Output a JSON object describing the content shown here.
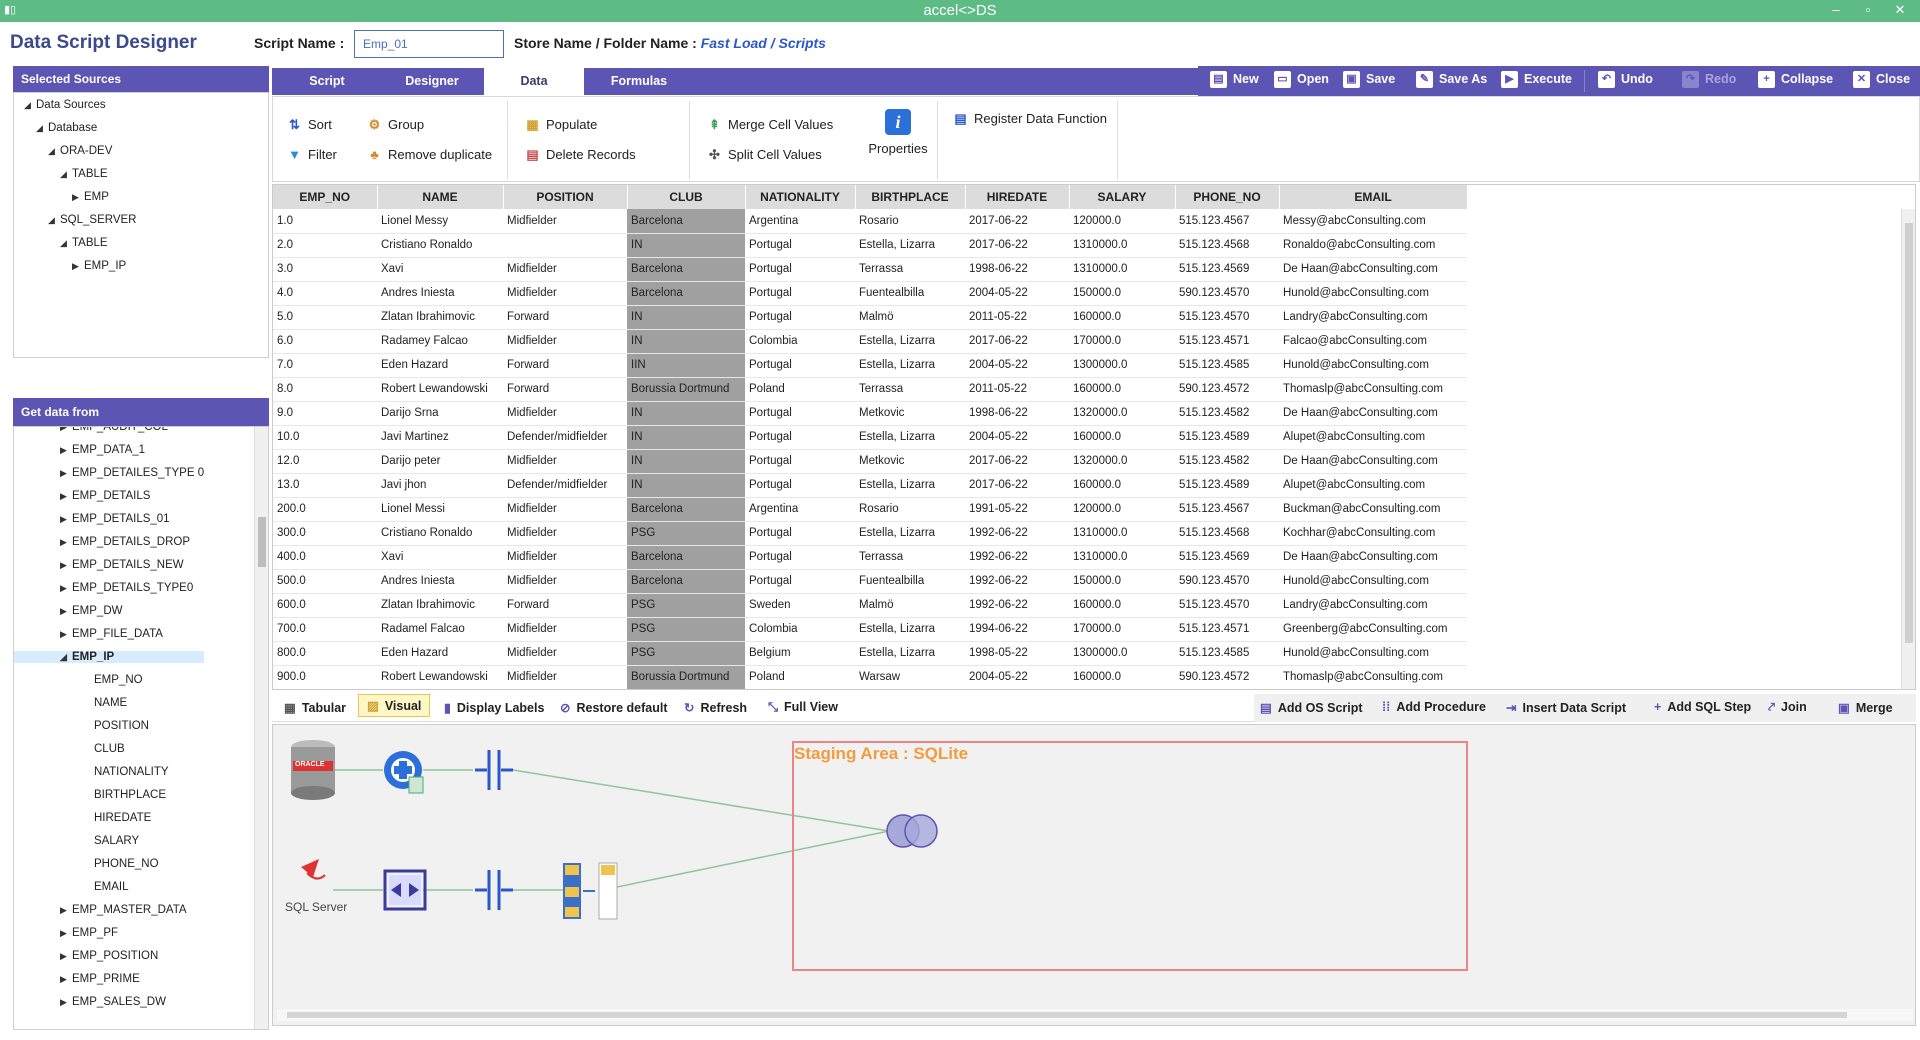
{
  "window": {
    "title": "accel<>DS",
    "min": "–",
    "max": "▫",
    "close": "✕"
  },
  "app": {
    "title": "Data Script Designer"
  },
  "script_name": {
    "label": "Script Name :",
    "value": "Emp_01"
  },
  "store": {
    "label": "Store Name / Folder Name :",
    "value": "Fast Load / Scripts"
  },
  "selected_sources": {
    "title": "Selected Sources",
    "tree": [
      {
        "label": "Data Sources",
        "level": 0,
        "open": true
      },
      {
        "label": "Database",
        "level": 1,
        "open": true
      },
      {
        "label": "ORA-DEV",
        "level": 2,
        "open": true
      },
      {
        "label": "TABLE",
        "level": 3,
        "open": true
      },
      {
        "label": "EMP",
        "level": 4,
        "open": false
      },
      {
        "label": "SQL_SERVER",
        "level": 2,
        "open": true
      },
      {
        "label": "TABLE",
        "level": 3,
        "open": true
      },
      {
        "label": "EMP_IP",
        "level": 4,
        "open": false
      }
    ]
  },
  "get_data": {
    "title": "Get data from",
    "items": [
      {
        "label": "EMP_AUDIT_COL",
        "type": "table"
      },
      {
        "label": "EMP_DATA_1",
        "type": "table"
      },
      {
        "label": "EMP_DETAILES_TYPE 0",
        "type": "table"
      },
      {
        "label": "EMP_DETAILS",
        "type": "table"
      },
      {
        "label": "EMP_DETAILS_01",
        "type": "table"
      },
      {
        "label": "EMP_DETAILS_DROP",
        "type": "table"
      },
      {
        "label": "EMP_DETAILS_NEW",
        "type": "table"
      },
      {
        "label": "EMP_DETAILS_TYPE0",
        "type": "table"
      },
      {
        "label": "EMP_DW",
        "type": "table"
      },
      {
        "label": "EMP_FILE_DATA",
        "type": "table"
      },
      {
        "label": "EMP_IP",
        "type": "table-open"
      },
      {
        "label": "EMP_NO",
        "type": "col"
      },
      {
        "label": "NAME",
        "type": "col"
      },
      {
        "label": "POSITION",
        "type": "col"
      },
      {
        "label": "CLUB",
        "type": "col"
      },
      {
        "label": "NATIONALITY",
        "type": "col"
      },
      {
        "label": "BIRTHPLACE",
        "type": "col"
      },
      {
        "label": "HIREDATE",
        "type": "col"
      },
      {
        "label": "SALARY",
        "type": "col"
      },
      {
        "label": "PHONE_NO",
        "type": "col"
      },
      {
        "label": "EMAIL",
        "type": "col"
      },
      {
        "label": "EMP_MASTER_DATA",
        "type": "table"
      },
      {
        "label": "EMP_PF",
        "type": "table"
      },
      {
        "label": "EMP_POSITION",
        "type": "table"
      },
      {
        "label": "EMP_PRIME",
        "type": "table"
      },
      {
        "label": "EMP_SALES_DW",
        "type": "table"
      }
    ]
  },
  "tabs": [
    {
      "label": "Script"
    },
    {
      "label": "Designer"
    },
    {
      "label": "Data"
    },
    {
      "label": "Formulas"
    }
  ],
  "toolbar": {
    "new": "New",
    "open": "Open",
    "save": "Save",
    "save_as": "Save As",
    "execute": "Execute",
    "undo": "Undo",
    "redo": "Redo",
    "collapse": "Collapse",
    "close": "Close"
  },
  "ribbon": {
    "sort": "Sort",
    "filter": "Filter",
    "group": "Group",
    "remove_duplicate": "Remove duplicate",
    "populate": "Populate",
    "delete_records": "Delete Records",
    "merge_cells": "Merge Cell Values",
    "split_cells": "Split Cell Values",
    "properties": "Properties",
    "register": "Register Data Function"
  },
  "grid": {
    "columns": [
      "EMP_NO",
      "NAME",
      "POSITION",
      "CLUB",
      "NATIONALITY",
      "BIRTHPLACE",
      "HIREDATE",
      "SALARY",
      "PHONE_NO",
      "EMAIL"
    ],
    "rows": [
      [
        "1.0",
        "Lionel Messy",
        "Midfielder",
        "Barcelona",
        "Argentina",
        "Rosario",
        "2017-06-22",
        "120000.0",
        "515.123.4567",
        "Messy@abcConsulting.com"
      ],
      [
        "2.0",
        "Cristiano Ronaldo",
        "",
        "IN",
        "Portugal",
        "Estella, Lizarra",
        "2017-06-22",
        "1310000.0",
        "515.123.4568",
        "Ronaldo@abcConsulting.com"
      ],
      [
        "3.0",
        "Xavi",
        "Midfielder",
        "Barcelona",
        "Portugal",
        "Terrassa",
        "1998-06-22",
        "1310000.0",
        "515.123.4569",
        "De Haan@abcConsulting.com"
      ],
      [
        "4.0",
        "Andres Iniesta",
        "Midfielder",
        "Barcelona",
        "Portugal",
        "Fuentealbilla",
        "2004-05-22",
        "150000.0",
        "590.123.4570",
        "Hunold@abcConsulting.com"
      ],
      [
        "5.0",
        "Zlatan Ibrahimovic",
        "Forward",
        "IN",
        "Portugal",
        "Malmö",
        "2011-05-22",
        "160000.0",
        "515.123.4570",
        "Landry@abcConsulting.com"
      ],
      [
        "6.0",
        "Radamey Falcao",
        "Midfielder",
        "IN",
        "Colombia",
        "Estella, Lizarra",
        "2017-06-22",
        "170000.0",
        "515.123.4571",
        "Falcao@abcConsulting.com"
      ],
      [
        "7.0",
        "Eden Hazard",
        "Forward",
        "IIN",
        "Portugal",
        "Estella, Lizarra",
        "2004-05-22",
        "1300000.0",
        "515.123.4585",
        "Hunold@abcConsulting.com"
      ],
      [
        "8.0",
        "Robert Lewandowski",
        "Forward",
        "Borussia Dortmund",
        "Poland",
        "Terrassa",
        "2011-05-22",
        "160000.0",
        "590.123.4572",
        "Thomaslp@abcConsulting.com"
      ],
      [
        "9.0",
        "Darijo Srna",
        "Midfielder",
        "IN",
        "Portugal",
        "Metkovic",
        "1998-06-22",
        "1320000.0",
        "515.123.4582",
        "De Haan@abcConsulting.com"
      ],
      [
        "10.0",
        "Javi Martinez",
        "Defender/midfielder",
        "IN",
        "Portugal",
        "Estella, Lizarra",
        "2004-05-22",
        "160000.0",
        "515.123.4589",
        "Alupet@abcConsulting.com"
      ],
      [
        "12.0",
        "Darijo peter",
        "Midfielder",
        "IN",
        "Portugal",
        "Metkovic",
        "2017-06-22",
        "1320000.0",
        "515.123.4582",
        "De Haan@abcConsulting.com"
      ],
      [
        "13.0",
        "Javi jhon",
        "Defender/midfielder",
        "IN",
        "Portugal",
        "Estella, Lizarra",
        "2017-06-22",
        "160000.0",
        "515.123.4589",
        "Alupet@abcConsulting.com"
      ],
      [
        "200.0",
        "Lionel Messi",
        "Midfielder",
        "Barcelona",
        "Argentina",
        "Rosario",
        "1991-05-22",
        "120000.0",
        "515.123.4567",
        "Buckman@abcConsulting.com"
      ],
      [
        "300.0",
        "Cristiano Ronaldo",
        "Midfielder",
        "PSG",
        "Portugal",
        "Estella, Lizarra",
        "1992-06-22",
        "1310000.0",
        "515.123.4568",
        "Kochhar@abcConsulting.com"
      ],
      [
        "400.0",
        "Xavi",
        "Midfielder",
        "Barcelona",
        "Portugal",
        "Terrassa",
        "1992-06-22",
        "1310000.0",
        "515.123.4569",
        "De Haan@abcConsulting.com"
      ],
      [
        "500.0",
        "Andres Iniesta",
        "Midfielder",
        "Barcelona",
        "Portugal",
        "Fuentealbilla",
        "1992-06-22",
        "150000.0",
        "590.123.4570",
        "Hunold@abcConsulting.com"
      ],
      [
        "600.0",
        "Zlatan Ibrahimovic",
        "Forward",
        "PSG",
        "Sweden",
        "Malmö",
        "1992-06-22",
        "160000.0",
        "515.123.4570",
        "Landry@abcConsulting.com"
      ],
      [
        "700.0",
        "Radamel Falcao",
        "Midfielder",
        "PSG",
        "Colombia",
        "Estella, Lizarra",
        "1994-06-22",
        "170000.0",
        "515.123.4571",
        "Greenberg@abcConsulting.com"
      ],
      [
        "800.0",
        "Eden Hazard",
        "Midfielder",
        "PSG",
        "Belgium",
        "Estella, Lizarra",
        "1998-05-22",
        "1300000.0",
        "515.123.4585",
        "Hunold@abcConsulting.com"
      ],
      [
        "900.0",
        "Robert Lewandowski",
        "Midfielder",
        "Borussia Dortmund",
        "Poland",
        "Warsaw",
        "2004-05-22",
        "160000.0",
        "590.123.4572",
        "Thomaslp@abcConsulting.com"
      ]
    ]
  },
  "viewbar": {
    "tabular": "Tabular",
    "visual": "Visual",
    "display_labels": "Display Labels",
    "restore": "Restore default",
    "refresh": "Refresh",
    "full_view": "Full View",
    "add_os": "Add OS Script",
    "add_proc": "Add Procedure",
    "insert_data": "Insert Data Script",
    "add_sql": "Add SQL Step",
    "join": "Join",
    "merge": "Merge"
  },
  "canvas": {
    "staging": "Staging Area : SQLite",
    "oracle_label": "ORACLE",
    "sqlserver_label": "SQL Server"
  },
  "colors": {
    "accent": "#5d55b3",
    "titlebar": "#5dbc85",
    "staging_border": "#e98585",
    "staging_text": "#f39c3d"
  }
}
